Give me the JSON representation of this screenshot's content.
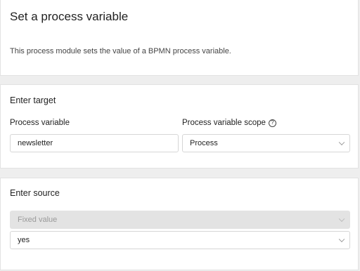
{
  "header": {
    "title": "Set a process variable",
    "description": "This process module sets the value of a BPMN process variable."
  },
  "target": {
    "section_title": "Enter target",
    "process_variable": {
      "label": "Process variable",
      "value": "newsletter"
    },
    "scope": {
      "label": "Process variable scope",
      "help_icon": "?",
      "selected": "Process"
    }
  },
  "source": {
    "section_title": "Enter source",
    "source_type": {
      "selected": "Fixed value",
      "disabled": true
    },
    "value": {
      "selected": "yes"
    }
  }
}
